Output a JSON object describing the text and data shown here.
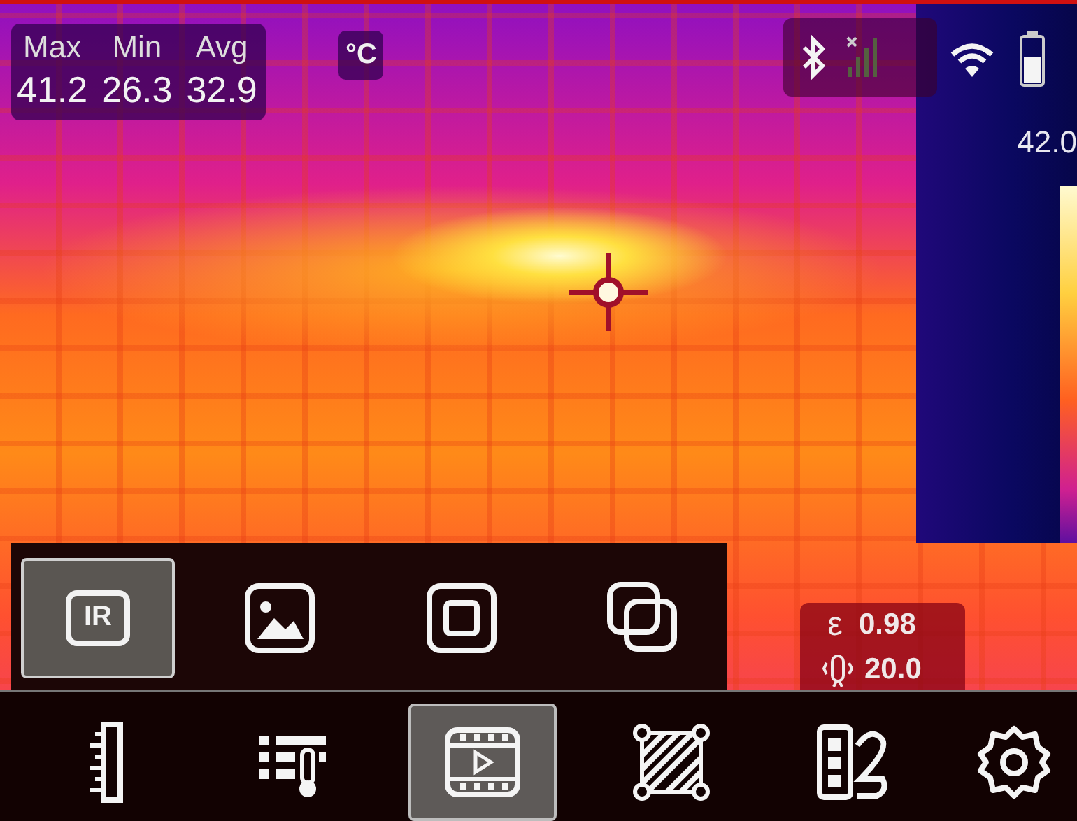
{
  "stats": {
    "labels": [
      "Max",
      "Min",
      "Avg"
    ],
    "values": [
      "41.2",
      "26.3",
      "32.9"
    ],
    "unit": "°C"
  },
  "scale": {
    "max": "42.0"
  },
  "modes": [
    {
      "kind": "ir",
      "label": "IR",
      "selected": true
    },
    {
      "kind": "visual",
      "selected": false
    },
    {
      "kind": "pip",
      "selected": false
    },
    {
      "kind": "fusion",
      "selected": false
    }
  ],
  "params": [
    {
      "kind": "emissivity",
      "symbol": "ε",
      "value": "0.98"
    },
    {
      "kind": "distance",
      "value": "20.0"
    }
  ],
  "toolbar": [
    {
      "kind": "ruler",
      "selected": false
    },
    {
      "kind": "palette",
      "selected": false
    },
    {
      "kind": "video",
      "selected": true
    },
    {
      "kind": "area",
      "selected": false
    },
    {
      "kind": "report",
      "selected": false
    },
    {
      "kind": "settings",
      "selected": false
    }
  ]
}
